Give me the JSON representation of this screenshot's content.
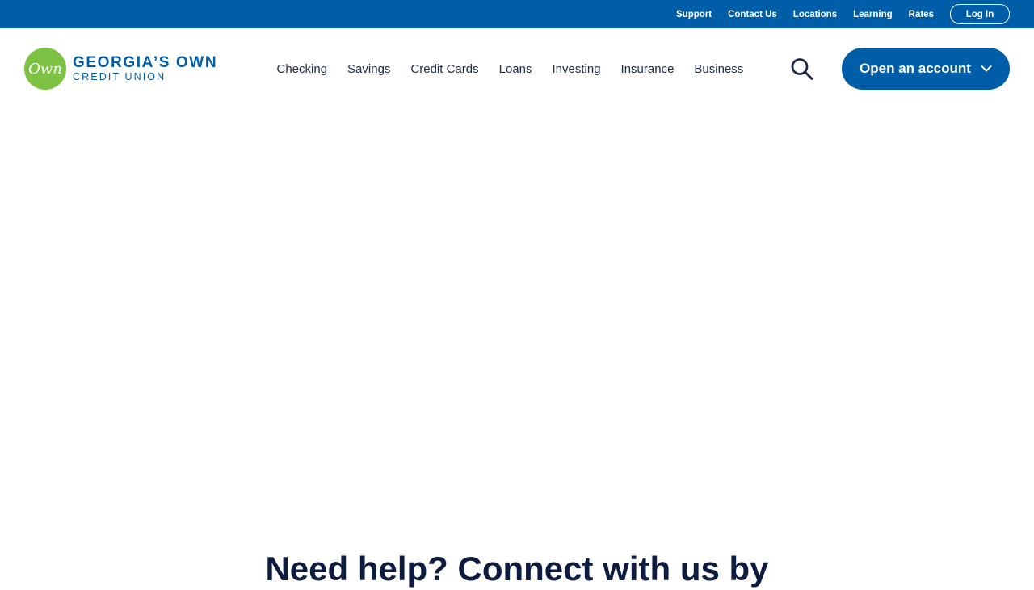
{
  "utility_nav": {
    "links": [
      "Support",
      "Contact Us",
      "Locations",
      "Learning",
      "Rates"
    ],
    "login_label": "Log In"
  },
  "brand": {
    "mark_text": "Own",
    "name_line1": "GEORGIA’S OWN",
    "name_line2": "CREDIT UNION"
  },
  "main_nav": {
    "items": [
      "Checking",
      "Savings",
      "Credit Cards",
      "Loans",
      "Investing",
      "Insurance",
      "Business"
    ]
  },
  "header_actions": {
    "search_icon": "search-icon",
    "open_account_label": "Open an account",
    "open_account_icon": "chevron-down-icon"
  },
  "help_section": {
    "heading": "Need help? Connect with us by"
  },
  "colors": {
    "brand_blue": "#005da8",
    "logo_green": "#7dc243",
    "nav_text": "#1e2a4a",
    "heading_text": "#0d1b3e"
  }
}
